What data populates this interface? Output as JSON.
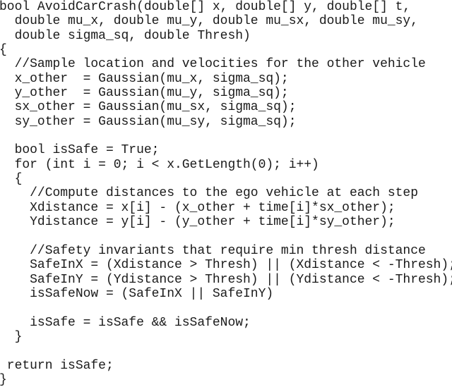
{
  "code": {
    "language": "C#",
    "lines": [
      "bool AvoidCarCrash(double[] x, double[] y, double[] t,",
      "  double mu_x, double mu_y, double mu_sx, double mu_sy,",
      "  double sigma_sq, double Thresh)",
      "{",
      "  //Sample location and velocities for the other vehicle",
      "  x_other  = Gaussian(mu_x, sigma_sq);",
      "  y_other  = Gaussian(mu_y, sigma_sq);",
      "  sx_other = Gaussian(mu_sx, sigma_sq);",
      "  sy_other = Gaussian(mu_sy, sigma_sq);",
      "",
      "  bool isSafe = True;",
      "  for (int i = 0; i < x.GetLength(0); i++)",
      "  {",
      "    //Compute distances to the ego vehicle at each step",
      "    Xdistance = x[i] - (x_other + time[i]*sx_other);",
      "    Ydistance = y[i] - (y_other + time[i]*sy_other);",
      "",
      "    //Safety invariants that require min thresh distance",
      "    SafeInX = (Xdistance > Thresh) || (Xdistance < -Thresh);",
      "    SafeInY = (Ydistance > Thresh) || (Ydistance < -Thresh);",
      "    isSafeNow = (SafeInX || SafeInY)",
      "",
      "    isSafe = isSafe && isSafeNow;",
      "  }",
      "",
      " return isSafe;",
      "}"
    ]
  }
}
